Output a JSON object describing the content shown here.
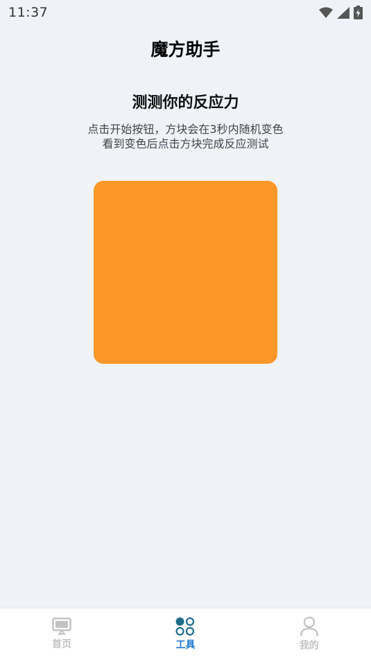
{
  "status_bar": {
    "time": "11:37",
    "icons": [
      "wifi-icon",
      "signal-icon",
      "battery-charging-icon"
    ]
  },
  "header": {
    "title": "魔方助手"
  },
  "main": {
    "test_title": "测测你的反应力",
    "instruction_line1": "点击开始按钮，方块会在3秒内随机变色",
    "instruction_line2": "看到变色后点击方块完成反应测试",
    "box_color": "#fd9728"
  },
  "bottom_nav": {
    "items": [
      {
        "label": "首页",
        "icon": "monitor-icon",
        "active": false
      },
      {
        "label": "工具",
        "icon": "tools-grid-icon",
        "active": true
      },
      {
        "label": "我的",
        "icon": "person-icon",
        "active": false
      }
    ]
  },
  "colors": {
    "background": "#eff3f7",
    "accent": "#1e78d0",
    "inactive": "#c2c2c2",
    "tools_icon": "#1e6c89"
  }
}
